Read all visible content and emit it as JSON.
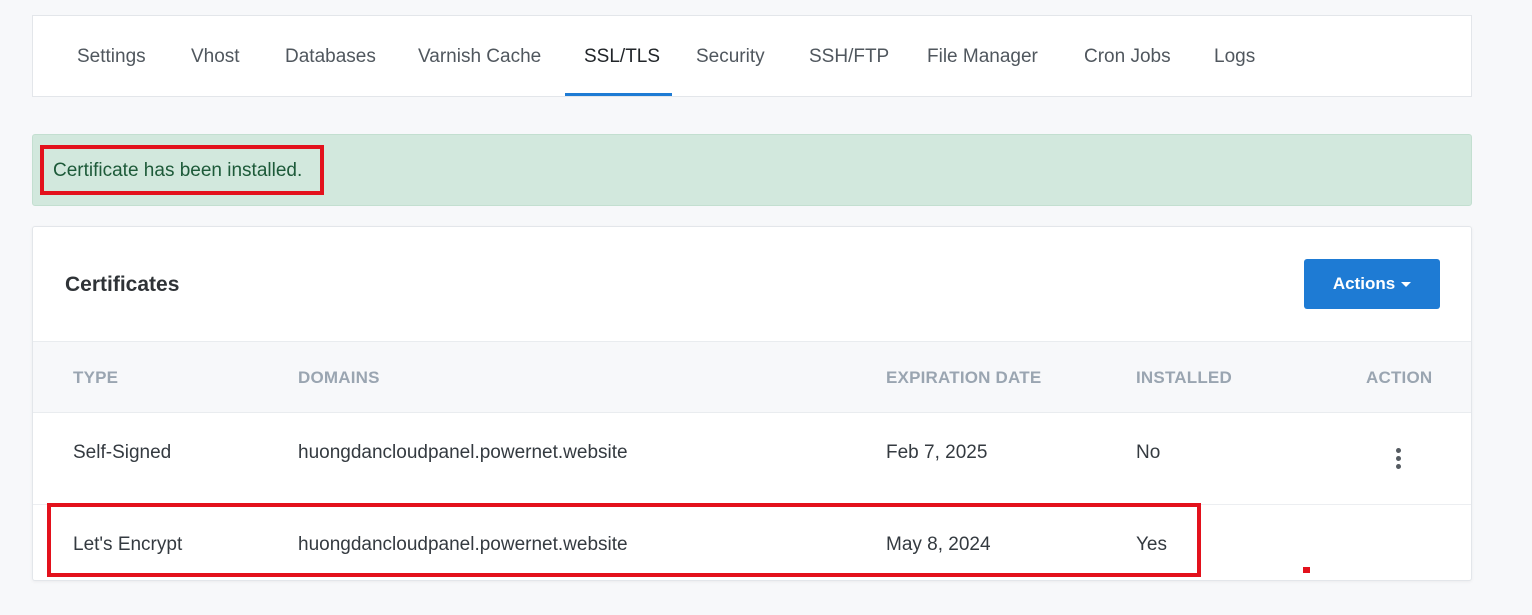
{
  "tabs": [
    {
      "label": "Settings",
      "active": false
    },
    {
      "label": "Vhost",
      "active": false
    },
    {
      "label": "Databases",
      "active": false
    },
    {
      "label": "Varnish Cache",
      "active": false
    },
    {
      "label": "SSL/TLS",
      "active": true
    },
    {
      "label": "Security",
      "active": false
    },
    {
      "label": "SSH/FTP",
      "active": false
    },
    {
      "label": "File Manager",
      "active": false
    },
    {
      "label": "Cron Jobs",
      "active": false
    },
    {
      "label": "Logs",
      "active": false
    }
  ],
  "alert": {
    "message": "Certificate has been installed."
  },
  "certificates": {
    "title": "Certificates",
    "actions_label": "Actions",
    "columns": [
      "TYPE",
      "DOMAINS",
      "EXPIRATION DATE",
      "INSTALLED",
      "ACTION"
    ],
    "rows": [
      {
        "type": "Self-Signed",
        "domains": "huongdancloudpanel.powernet.website",
        "expiration": "Feb 7, 2025",
        "installed": "No",
        "has_action_menu": true
      },
      {
        "type": "Let's Encrypt",
        "domains": "huongdancloudpanel.powernet.website",
        "expiration": "May 8, 2024",
        "installed": "Yes",
        "has_action_menu": false
      }
    ]
  },
  "colors": {
    "accent": "#1e7bd4",
    "alert_background": "#d2e8dd",
    "alert_text": "#1d5a39",
    "annotation_red": "#e3111c"
  }
}
